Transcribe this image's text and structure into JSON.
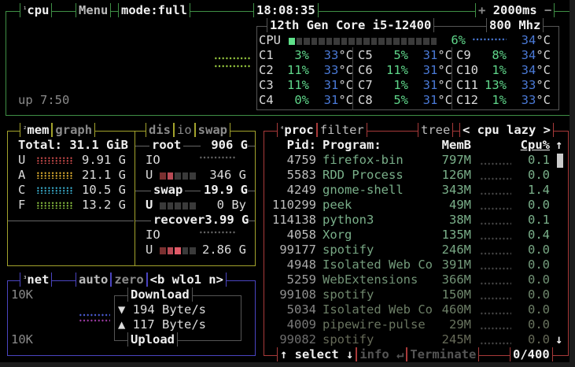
{
  "cpu": {
    "title_num": "¹",
    "title": "cpu",
    "menu": "Menu",
    "mode": "mode:full",
    "clock": "18:08:35",
    "plus": "+",
    "interval": "2000ms",
    "minus": "−",
    "model": "12th Gen Core i5-12400",
    "freq": "800 Mhz",
    "total_label": "CPU",
    "total_pct": "6%",
    "total_pct_value": 6,
    "total_temp": "34°C",
    "uptime": "up 7:50",
    "cores": [
      {
        "name": "C1",
        "pct": "3%",
        "temp": "33°C"
      },
      {
        "name": "C2",
        "pct": "11%",
        "temp": "33°C"
      },
      {
        "name": "C3",
        "pct": "11%",
        "temp": "31°C"
      },
      {
        "name": "C4",
        "pct": "0%",
        "temp": "31°C"
      },
      {
        "name": "C5",
        "pct": "5%",
        "temp": "31°C"
      },
      {
        "name": "C6",
        "pct": "11%",
        "temp": "31°C"
      },
      {
        "name": "C7",
        "pct": "1%",
        "temp": "31°C"
      },
      {
        "name": "C8",
        "pct": "5%",
        "temp": "31°C"
      },
      {
        "name": "C9",
        "pct": "8%",
        "temp": "34°C"
      },
      {
        "name": "C10",
        "pct": "1%",
        "temp": "34°C"
      },
      {
        "name": "C11",
        "pct": "13%",
        "temp": "33°C"
      },
      {
        "name": "C12",
        "pct": "1%",
        "temp": "33°C"
      }
    ]
  },
  "mem": {
    "title_num": "²",
    "title": "mem",
    "graph": "graph",
    "total": "Total: 31.1 GiB",
    "rows": [
      {
        "label": "U",
        "value": "9.91 G",
        "color": "#c84a4a"
      },
      {
        "label": "A",
        "value": "21.1 G",
        "color": "#e0b030"
      },
      {
        "label": "C",
        "value": "10.5 G",
        "color": "#3ab0d0"
      },
      {
        "label": "F",
        "value": "13.2 G",
        "color": "#8ac040"
      }
    ]
  },
  "disks": {
    "tab1": "dis",
    "tab2": "io",
    "tab3": "swap",
    "root": {
      "name": "root",
      "size": "906 G",
      "io": "IO",
      "used_label": "U",
      "used": "346 G"
    },
    "swap": {
      "name": "swap",
      "size": "19.9 G",
      "used_label": "U",
      "used": "0 By"
    },
    "recover": {
      "name": "recover",
      "size": "3.99 G",
      "io": "IO",
      "used_label": "U",
      "used": "2.86 G"
    }
  },
  "net": {
    "title_num": "³",
    "title": "net",
    "auto": "auto",
    "zero": "zero",
    "iface": "<b wlo1 n>",
    "scale_top": "10K",
    "scale_bottom": "10K",
    "download_label": "Download",
    "download": "▼ 194 Byte/s",
    "upload": "▲ 117 Byte/s",
    "upload_label": "Upload"
  },
  "proc": {
    "title_num": "⁴",
    "title": "proc",
    "filter": "filter",
    "tree": "tree",
    "sort": "< cpu lazy >",
    "col_pid": "Pid:",
    "col_program": "Program:",
    "col_mem": "MemB",
    "col_cpu": "Cpu%",
    "up_arrow": "↑",
    "down_arrow": "↓",
    "rows": [
      {
        "pid": "4759",
        "program": "firefox-bin",
        "mem": "797M",
        "cpu": "0.1"
      },
      {
        "pid": "5583",
        "program": "RDD Process",
        "mem": "126M",
        "cpu": "0.0"
      },
      {
        "pid": "4249",
        "program": "gnome-shell",
        "mem": "343M",
        "cpu": "1.4"
      },
      {
        "pid": "110299",
        "program": "peek",
        "mem": "49M",
        "cpu": "0.0"
      },
      {
        "pid": "114138",
        "program": "python3",
        "mem": "38M",
        "cpu": "0.1"
      },
      {
        "pid": "4058",
        "program": "Xorg",
        "mem": "135M",
        "cpu": "0.4"
      },
      {
        "pid": "99177",
        "program": "spotify",
        "mem": "246M",
        "cpu": "0.0"
      },
      {
        "pid": "4948",
        "program": "Isolated Web Co",
        "mem": "391M",
        "cpu": "0.0"
      },
      {
        "pid": "5259",
        "program": "WebExtensions",
        "mem": "366M",
        "cpu": "0.0"
      },
      {
        "pid": "99108",
        "program": "spotify",
        "mem": "150M",
        "cpu": "0.0"
      },
      {
        "pid": "5034",
        "program": "Isolated Web Co",
        "mem": "460M",
        "cpu": "0.0"
      },
      {
        "pid": "4009",
        "program": "pipewire-pulse",
        "mem": "29M",
        "cpu": "0.0"
      },
      {
        "pid": "99082",
        "program": "spotify",
        "mem": "245M",
        "cpu": "0.0"
      }
    ],
    "select": "↑ select ↓",
    "info": "info ↵",
    "terminate": "Terminate",
    "count": "0/400"
  }
}
